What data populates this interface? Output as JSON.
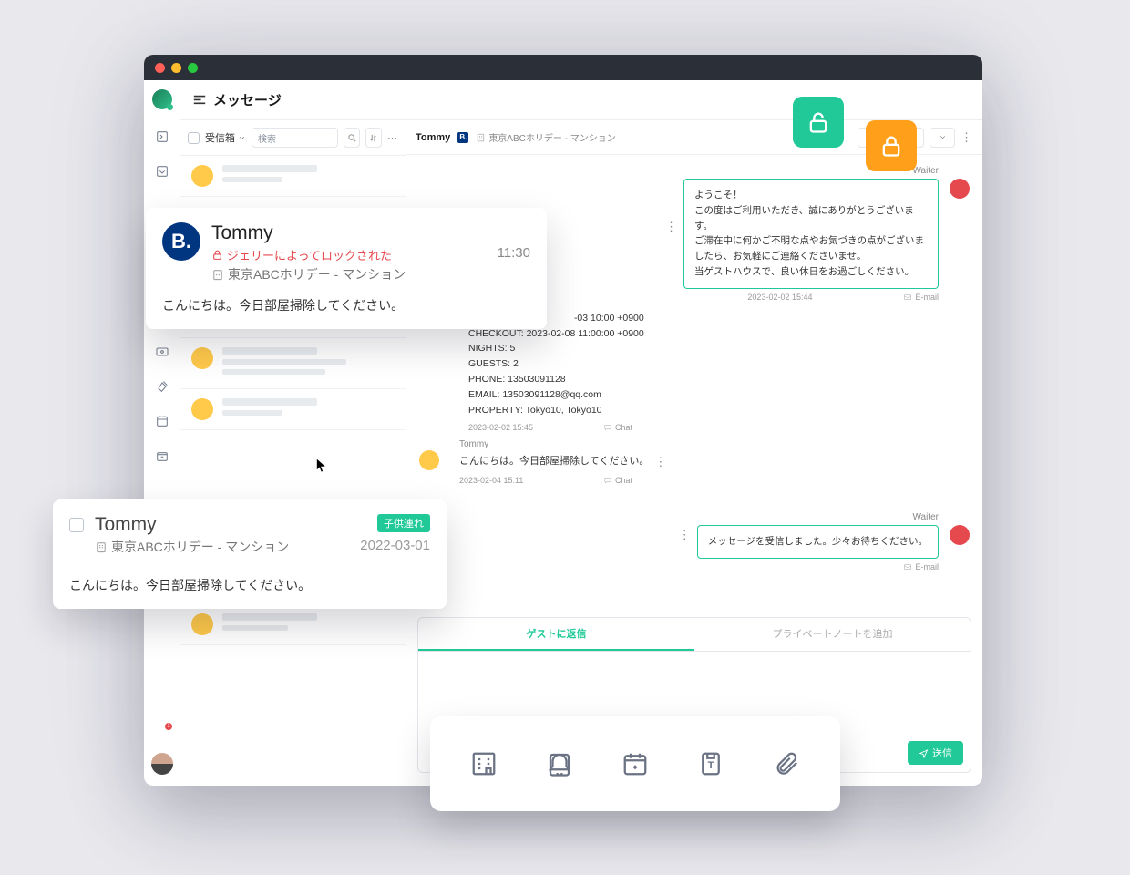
{
  "header": {
    "title": "メッセージ"
  },
  "inbox": {
    "label": "受信箱",
    "search_placeholder": "検索"
  },
  "thread": {
    "name": "Tommy",
    "property": "東京ABCホリデー - マンション",
    "pill1": "...",
    "messages": {
      "waiter1_sender": "Waiter",
      "waiter1_body": "ようこそ！\nこの度はご利用いただき、誠にありがとうございます。\nご滞在中に何かご不明な点やお気づきの点がございましたら、お気軽にご連絡くださいませ。\n当ゲストハウスで、良い休日をお過ごしください。",
      "waiter1_time": "2023-02-02 15:44",
      "waiter1_channel": "E-mail",
      "sys_line1": "-03 10:00 +0900",
      "sys_line2": "CHECKOUT: 2023-02-08 11:00:00 +0900",
      "sys_line3": "NIGHTS: 5",
      "sys_line4": "GUESTS: 2",
      "sys_line5": "PHONE: 13503091128",
      "sys_line6": "EMAIL: 13503091128@qq.com",
      "sys_line7": "PROPERTY: Tokyo10, Tokyo10",
      "sys_time": "2023-02-02 15:45",
      "sys_channel": "Chat",
      "tommy_sender": "Tommy",
      "tommy_body": "こんにちは。今日部屋掃除してください。",
      "tommy_time": "2023-02-04 15:11",
      "tommy_channel": "Chat",
      "waiter2_sender": "Waiter",
      "waiter2_body": "メッセージを受信しました。少々お待ちください。",
      "waiter2_channel": "E-mail"
    }
  },
  "composer": {
    "tab_reply": "ゲストに返信",
    "tab_note": "プライベートノートを追加",
    "send": "送信"
  },
  "card1": {
    "name": "Tommy",
    "locked": "ジェリーによってロックされた",
    "property": "東京ABCホリデー - マンション",
    "time": "11:30",
    "preview": "こんにちは。今日部屋掃除してください。"
  },
  "card2": {
    "name": "Tommy",
    "property": "東京ABCホリデー - マンション",
    "tag": "子供連れ",
    "date": "2022-03-01",
    "preview": "こんにちは。今日部屋掃除してください。"
  }
}
